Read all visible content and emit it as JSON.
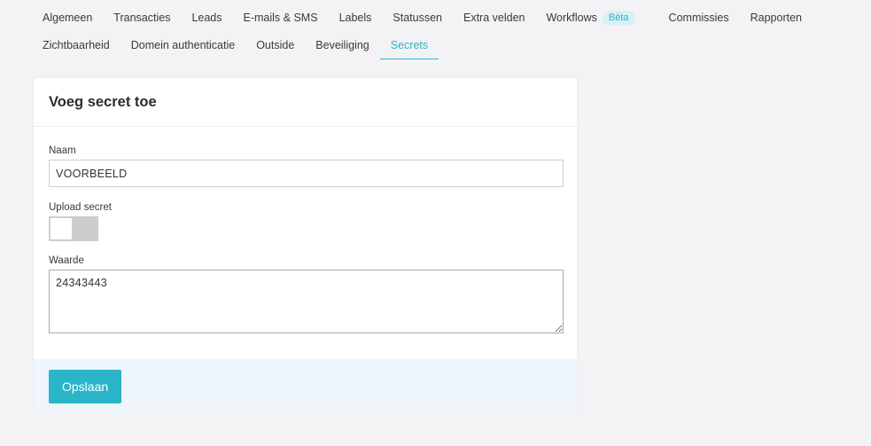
{
  "tabs": {
    "row1": [
      {
        "label": "Algemeen"
      },
      {
        "label": "Transacties"
      },
      {
        "label": "Leads"
      },
      {
        "label": "E-mails & SMS"
      },
      {
        "label": "Labels"
      },
      {
        "label": "Statussen"
      },
      {
        "label": "Extra velden"
      },
      {
        "label": "Workflows",
        "badge": "Bèta"
      },
      {
        "label": "Commissies"
      },
      {
        "label": "Rapporten"
      }
    ],
    "row2": [
      {
        "label": "Zichtbaarheid"
      },
      {
        "label": "Domein authenticatie"
      },
      {
        "label": "Outside"
      },
      {
        "label": "Beveiliging"
      },
      {
        "label": "Secrets",
        "active": true
      }
    ]
  },
  "form": {
    "title": "Voeg secret toe",
    "name_label": "Naam",
    "name_value": "VOORBEELD",
    "upload_label": "Upload secret",
    "upload_enabled": false,
    "value_label": "Waarde",
    "value_value": "24343443",
    "save_label": "Opslaan"
  },
  "colors": {
    "accent": "#2bb5c9",
    "footer_bg": "#eef6fc",
    "page_bg": "#f3f3f5"
  }
}
